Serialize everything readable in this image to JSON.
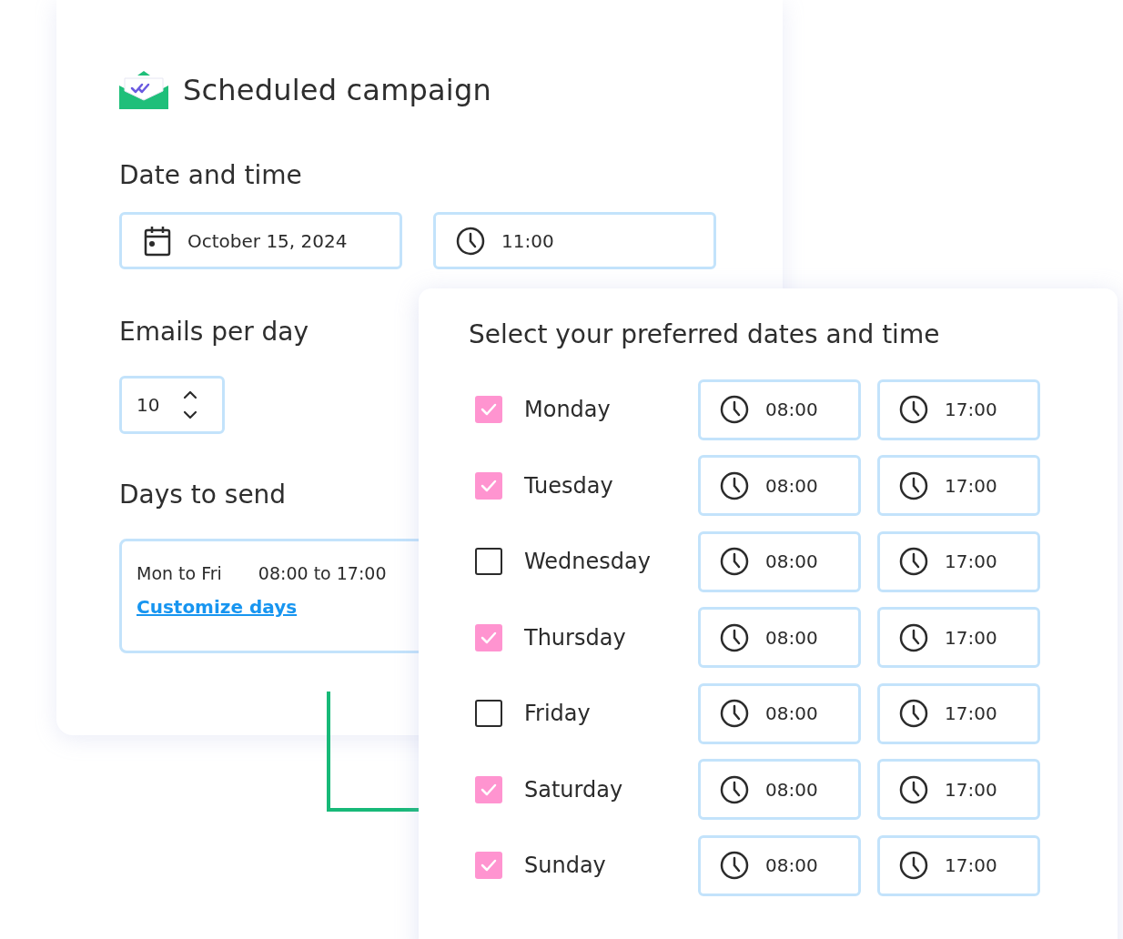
{
  "header": {
    "title": "Scheduled campaign"
  },
  "date_time": {
    "heading": "Date and time",
    "date": "October 15, 2024",
    "time": "11:00"
  },
  "emails_per_day": {
    "heading": "Emails per day",
    "value": "10"
  },
  "days_to_send": {
    "heading": "Days to send",
    "days": "Mon to Fri",
    "hours": "08:00 to 17:00",
    "link": "Customize days"
  },
  "preferences": {
    "title": "Select your preferred dates and time",
    "days": [
      {
        "day": "Monday",
        "checked": true,
        "start": "08:00",
        "end": "17:00"
      },
      {
        "day": "Tuesday",
        "checked": true,
        "start": "08:00",
        "end": "17:00"
      },
      {
        "day": "Wednesday",
        "checked": false,
        "start": "08:00",
        "end": "17:00"
      },
      {
        "day": "Thursday",
        "checked": true,
        "start": "08:00",
        "end": "17:00"
      },
      {
        "day": "Friday",
        "checked": false,
        "start": "08:00",
        "end": "17:00"
      },
      {
        "day": "Saturday",
        "checked": true,
        "start": "08:00",
        "end": "17:00"
      },
      {
        "day": "Sunday",
        "checked": true,
        "start": "08:00",
        "end": "17:00"
      }
    ]
  }
}
